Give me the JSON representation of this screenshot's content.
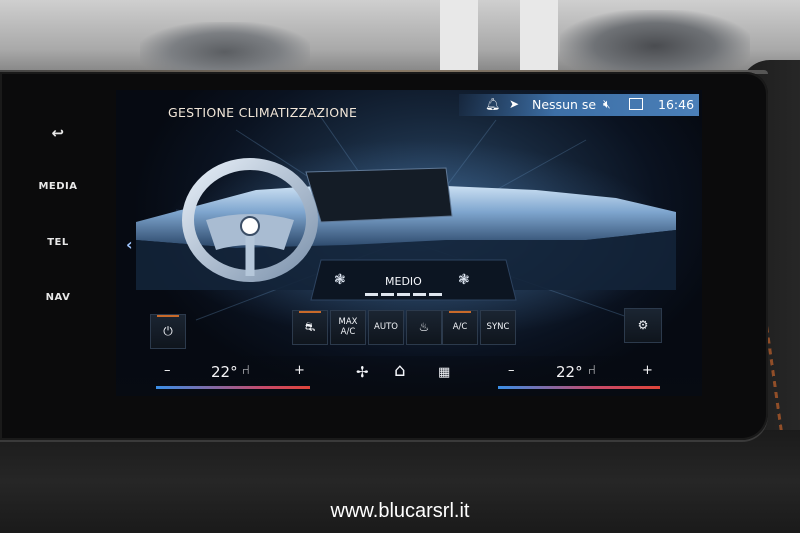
{
  "side_buttons": {
    "back_glyph": "↩",
    "media": "MEDIA",
    "tel": "TEL",
    "nav": "NAV"
  },
  "header": {
    "title": "GESTIONE CLIMATIZZAZIONE"
  },
  "status_bar": {
    "bell_icon": "bell-icon",
    "location_icon": "navigation-arrow-icon",
    "connection_text": "Nessun se",
    "mute_icon": "mute-icon",
    "profile_icon": "driver-profile-icon",
    "time": "16:46"
  },
  "fan": {
    "level_label": "MEDIO",
    "level_segments_total": 5,
    "level_segments_active": 5
  },
  "buttons": {
    "power_glyph": "⏻",
    "recirculation_glyph": "⛐",
    "max_ac_line1": "MAX",
    "max_ac_line2": "A/C",
    "auto": "AUTO",
    "defrost_glyph": "♨",
    "ac": "A/C",
    "sync": "SYNC",
    "settings_glyph": "⚙"
  },
  "zones": {
    "left": {
      "minus": "–",
      "temp": "22°",
      "seat_glyph": "⑁",
      "plus": "+"
    },
    "right": {
      "minus": "–",
      "temp": "22°",
      "seat_glyph": "⑁",
      "plus": "+"
    }
  },
  "nav_bar": {
    "fan_glyph": "✢",
    "home_glyph": "⌂",
    "apps_glyph": "▦"
  },
  "watermark": "www.blucarsrl.it",
  "colors": {
    "accent_orange": "#c86a2a",
    "status_blue": "#4a7fb8",
    "cold": "#3a8ee6",
    "warm": "#e0453a"
  }
}
